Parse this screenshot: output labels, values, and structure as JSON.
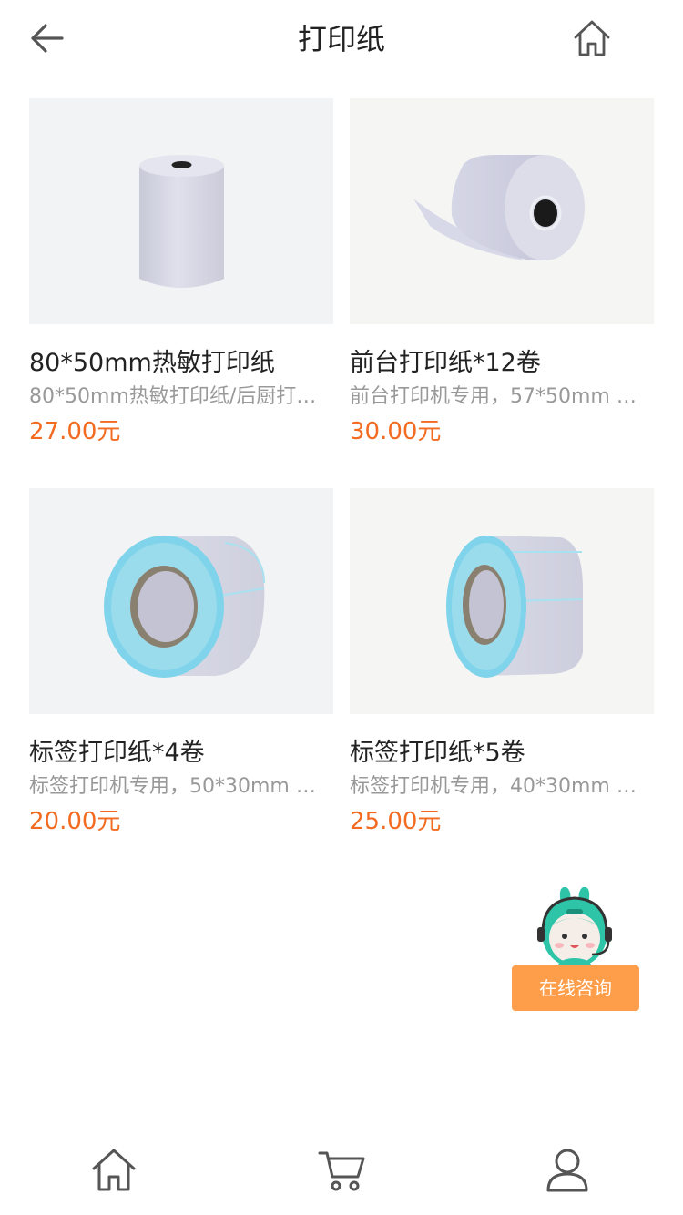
{
  "header": {
    "title": "打印纸",
    "back_icon": "arrow-left-icon",
    "home_icon": "home-icon"
  },
  "products": [
    {
      "name": "80*50mm热敏打印纸",
      "description": "80*50mm热敏打印纸/后厨打…",
      "price": "27.00元",
      "image": "thermal-paper-roll"
    },
    {
      "name": "前台打印纸*12卷",
      "description": "前台打印机专用，57*50mm …",
      "price": "30.00元",
      "image": "unrolled-paper-roll"
    },
    {
      "name": "标签打印纸*4卷",
      "description": "标签打印机专用，50*30mm …",
      "price": "20.00元",
      "image": "label-roll"
    },
    {
      "name": "标签打印纸*5卷",
      "description": "标签打印机专用，40*30mm …",
      "price": "25.00元",
      "image": "label-roll-narrow"
    }
  ],
  "consult": {
    "label": "在线咨询",
    "mascot_icon": "support-mascot-icon"
  },
  "bottom_nav": {
    "items": [
      {
        "icon": "home-icon"
      },
      {
        "icon": "cart-icon"
      },
      {
        "icon": "user-icon"
      }
    ]
  },
  "colors": {
    "price": "#f36b21",
    "consult_button": "#ff9e4a",
    "mascot": "#2ec4a8",
    "label_edge": "#7fd3ea"
  }
}
